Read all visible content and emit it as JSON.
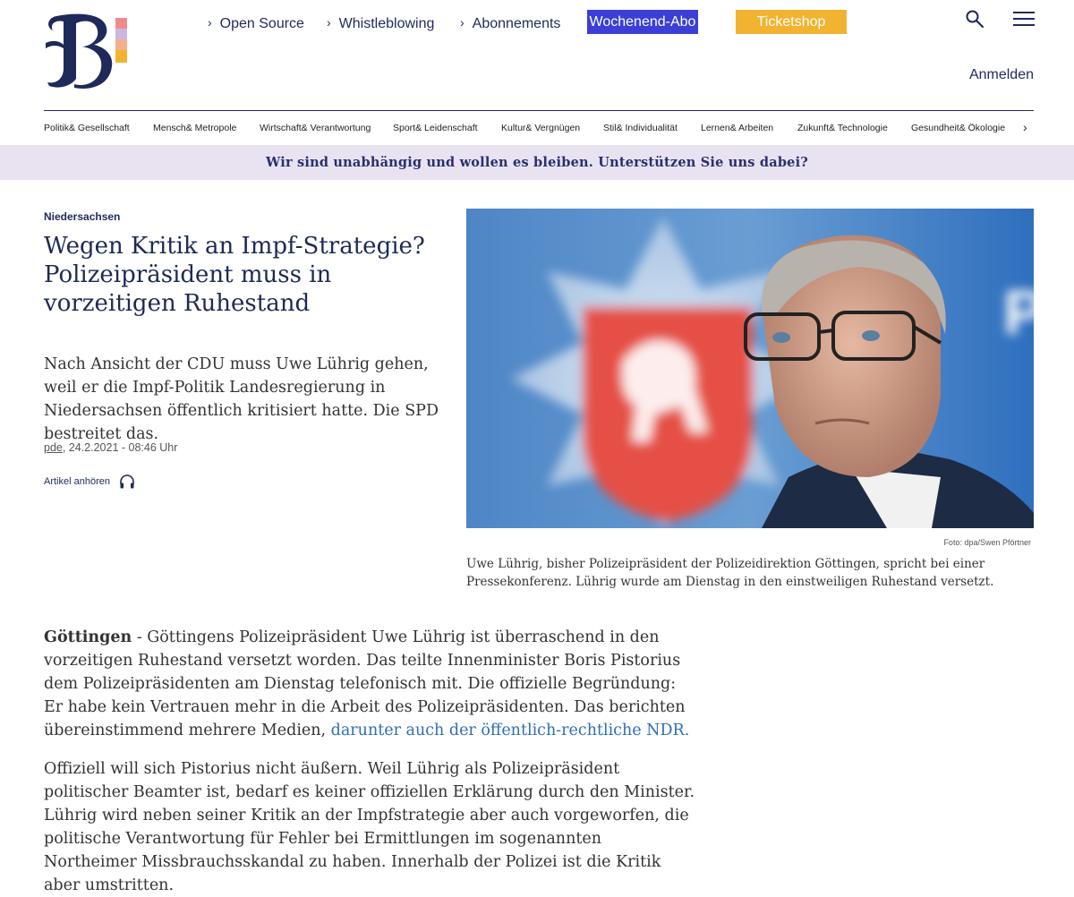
{
  "header": {
    "logo_icon": "berliner-zeitung-b-logo",
    "nav": [
      {
        "label": "Open Source"
      },
      {
        "label": "Whistleblowing"
      },
      {
        "label": "Abonnements"
      }
    ],
    "abo_button": "Wochenend-Abo",
    "ticket_button": "Ticketshop",
    "login": "Anmelden",
    "search_icon": "search-icon",
    "menu_icon": "hamburger-menu-icon"
  },
  "categories": [
    "Politik& Gesellschaft",
    "Mensch& Metropole",
    "Wirtschaft& Verantwortung",
    "Sport& Leidenschaft",
    "Kultur& Vergnügen",
    "Stil& Individualität",
    "Lernen& Arbeiten",
    "Zukunft& Technologie",
    "Gesundheit& Ökologie"
  ],
  "banner": "Wir sind unabhängig und wollen es bleiben. Unterstützen Sie uns dabei?",
  "article": {
    "kicker": "Niedersachsen",
    "headline": "Wegen Kritik an Impf-Strategie? Polizeipräsident muss in vorzeitigen Ruhestand",
    "teaser": "Nach Ansicht der CDU muss Uwe Lührig gehen, weil er die Impf-Politik Landesregierung in Niedersachsen öffentlich kritisiert hatte. Die SPD bestreitet das.",
    "author": "pde",
    "date": ", 24.2.2021 - 08:46 Uhr",
    "listen_label": "Artikel anhören",
    "photo_credit": "Foto: dpa/Swen Pförtner",
    "photo_caption": "Uwe Lührig, bisher Polizeipräsident der Polizeidirektion Göttingen, spricht bei einer Pressekonferenz. Lührig wurde am Dienstag in den einstweiligen Ruhestand versetzt.",
    "para1_dateline": "Göttingen",
    "para1_text": " - Göttingens Polizeipräsident Uwe Lührig ist überraschend in den vorzeitigen Ruhestand versetzt worden. Das teilte Innenminister Boris Pistorius dem Polizeipräsidenten am Dienstag telefonisch mit. Die offizielle Begründung: Er habe kein Vertrauen mehr in die Arbeit des Polizeipräsidenten. Das berichten übereinstimmend mehrere Medien, ",
    "para1_link": "darunter auch der öffentlich-rechtliche NDR.",
    "para2_text": "Offiziell will sich Pistorius nicht äußern. Weil Lührig als Polizeipräsident politischer Beamter ist, bedarf es keiner offiziellen Erklärung durch den Minister. Lührig wird neben seiner Kritik an der Impfstrategie aber auch vorgeworfen, die politische Verantwortung für Fehler bei Ermittlungen im sogenannten Northeimer Missbrauchsskandal zu haben. Innerhalb der Polizei ist die Kritik aber umstritten."
  },
  "colors": {
    "navy": "#1f2a5a",
    "abo": "#3b3fd6",
    "ticket": "#f2b330",
    "banner_bg": "#e9e3f1",
    "link": "#2f6eb5"
  }
}
